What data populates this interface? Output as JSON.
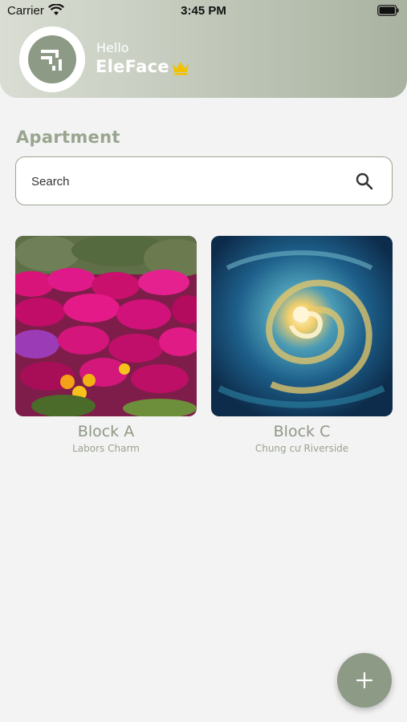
{
  "status_bar": {
    "carrier": "Carrier",
    "time": "3:45 PM"
  },
  "header": {
    "greeting": "Hello",
    "username": "EleFace",
    "crown_icon": "crown-icon",
    "crown_color": "#f2c200"
  },
  "section": {
    "title": "Apartment"
  },
  "search": {
    "placeholder": "Search",
    "icon": "search-icon"
  },
  "cards": [
    {
      "title": "Block A",
      "subtitle": "Labors Charm",
      "image": "flower-field-photo"
    },
    {
      "title": "Block C",
      "subtitle": "Chung cư Riverside",
      "image": "swirl-painting"
    }
  ],
  "fab": {
    "icon": "plus-icon"
  },
  "colors": {
    "accent": "#8d9a86",
    "title": "#9aa58f",
    "background": "#f3f3f3"
  }
}
